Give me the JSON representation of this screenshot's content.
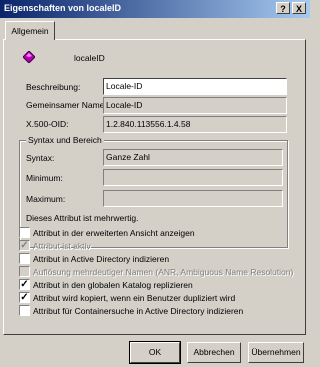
{
  "window": {
    "title": "Eigenschaften von localeID",
    "help_btn": "?",
    "close_btn": "X"
  },
  "tabs": [
    {
      "label": "Allgemein"
    }
  ],
  "header": {
    "icon": "attribute-icon",
    "name": "localeID"
  },
  "fields": {
    "description_label": "Beschreibung:",
    "description_value": "Locale-ID",
    "common_name_label": "Gemeinsamer Name:",
    "common_name_value": "Locale-ID",
    "oid_label": "X.500-OID:",
    "oid_value": "1.2.840.113556.1.4.58"
  },
  "syntax_group": {
    "title": "Syntax und Bereich",
    "syntax_label": "Syntax:",
    "syntax_value": "Ganze Zahl",
    "minimum_label": "Minimum:",
    "minimum_value": "",
    "maximum_label": "Maximum:",
    "maximum_value": "",
    "multivalue_note": "Dieses Attribut ist mehrwertig."
  },
  "checkboxes": [
    {
      "label": "Attribut in der erweiterten Ansicht anzeigen",
      "checked": false,
      "enabled": true
    },
    {
      "label": "Attribut ist aktiv",
      "checked": true,
      "enabled": false
    },
    {
      "label": "Attribut in Active Directory indizieren",
      "checked": false,
      "enabled": true
    },
    {
      "label": "Auflösung mehrdeutiger Namen (ANR, Ambiguous Name Resolution)",
      "checked": false,
      "enabled": false
    },
    {
      "label": "Attribut in den globalen Katalog replizieren",
      "checked": true,
      "enabled": true
    },
    {
      "label": "Attribut wird kopiert, wenn ein Benutzer dupliziert wird",
      "checked": true,
      "enabled": true
    },
    {
      "label": "Attribut für Containersuche in Active Directory indizieren",
      "checked": false,
      "enabled": true
    }
  ],
  "buttons": {
    "ok": "OK",
    "cancel": "Abbrechen",
    "apply": "Übernehmen"
  },
  "colors": {
    "title_start": "#0a246a",
    "title_end": "#a6caf0",
    "face": "#d4d0c8",
    "icon": "#b400b4"
  }
}
